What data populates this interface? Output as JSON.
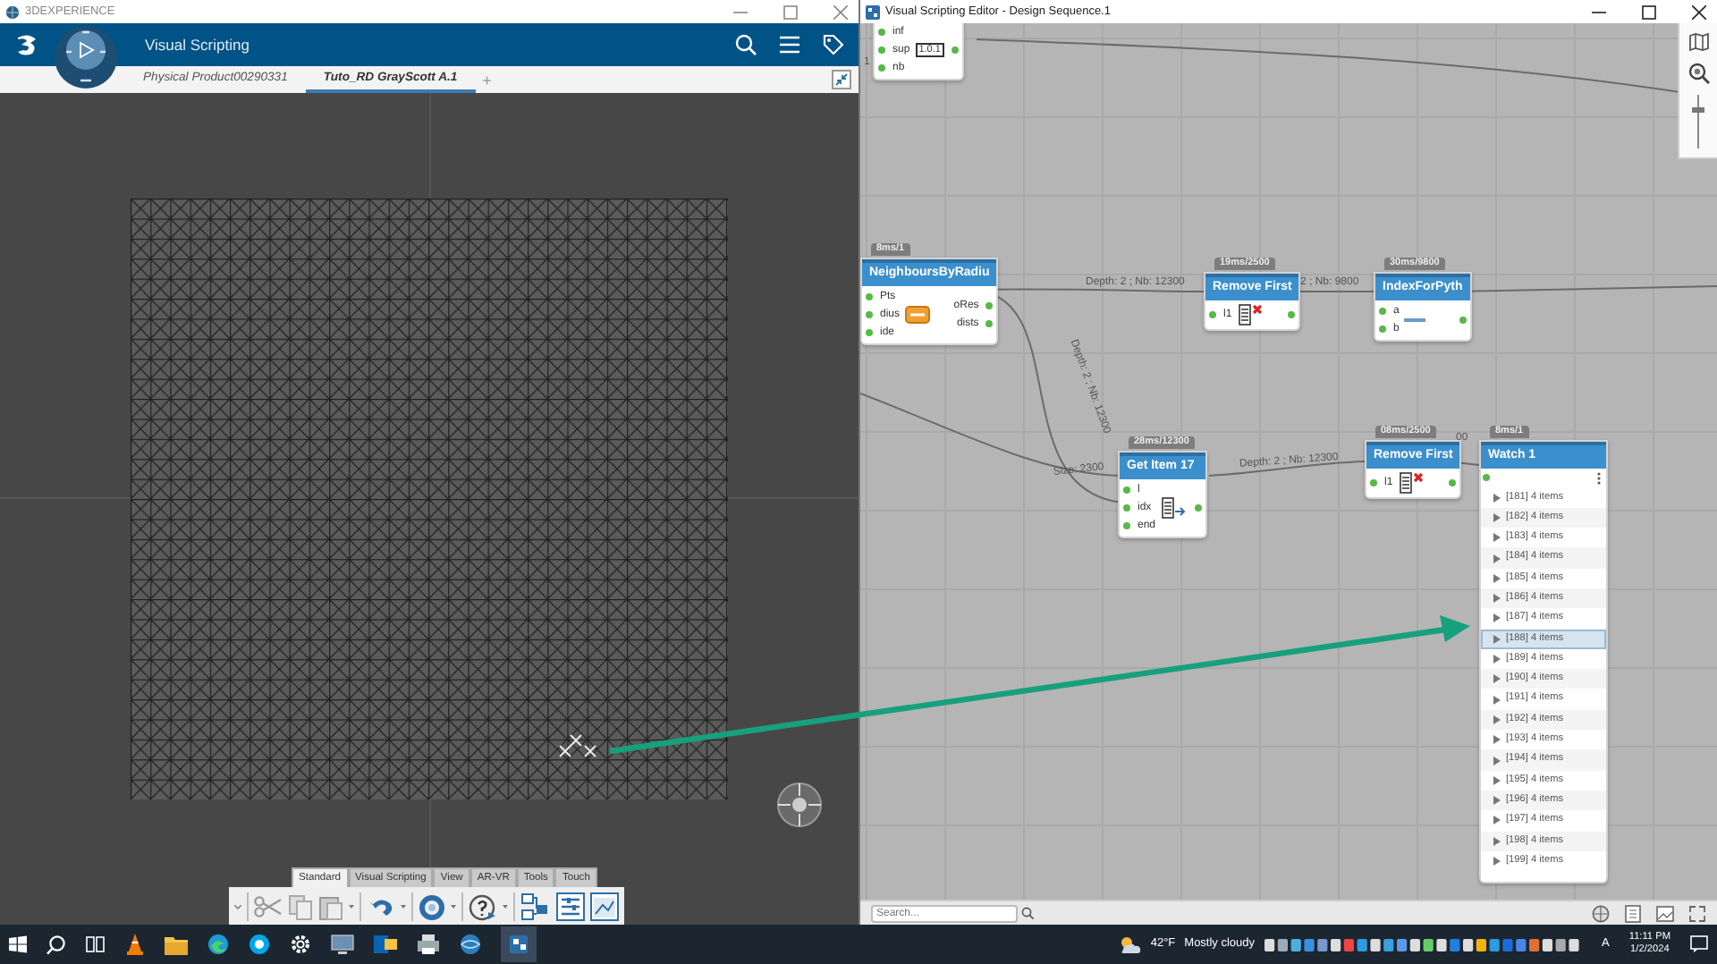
{
  "left_window": {
    "title": "3DEXPERIENCE",
    "app_title": "Visual Scripting",
    "tabs": [
      {
        "label": "Physical Product00290331",
        "selected": false
      },
      {
        "label": "Tuto_RD GrayScott A.1",
        "selected": true
      }
    ],
    "add_tab": "+",
    "toolbar_tabs": [
      {
        "label": "Standard",
        "selected": true
      },
      {
        "label": "Visual Scripting",
        "selected": false
      },
      {
        "label": "View",
        "selected": false
      },
      {
        "label": "AR-VR",
        "selected": false
      },
      {
        "label": "Tools",
        "selected": false
      },
      {
        "label": "Touch",
        "selected": false
      }
    ]
  },
  "editor_window": {
    "title": "Visual Scripting Editor - Design Sequence.1",
    "nodes": [
      {
        "kind": "range",
        "inputs": [
          {
            "label": "inf"
          },
          {
            "label": "sup",
            "value": "1.0.1"
          },
          {
            "label": "nb"
          }
        ]
      },
      {
        "kind": "neighbours",
        "timing": "8ms/1",
        "title": "NeighboursByRadiu",
        "inputs": [
          {
            "label": "Pts"
          },
          {
            "label": "dius"
          },
          {
            "label": "ide"
          }
        ],
        "outputs": [
          "oRes",
          "dists"
        ]
      },
      {
        "kind": "remove",
        "timing": "19ms/2500",
        "title": "Remove First",
        "inputs": [
          {
            "label": "l1"
          }
        ]
      },
      {
        "kind": "index",
        "timing": "30ms/9800",
        "title": "IndexForPyth",
        "inputs": [
          {
            "label": "a"
          },
          {
            "label": "b"
          }
        ]
      },
      {
        "kind": "get",
        "timing": "28ms/12300",
        "title": "Get Item 17",
        "inputs": [
          {
            "label": "l"
          },
          {
            "label": "idx"
          },
          {
            "label": "end"
          }
        ]
      },
      {
        "kind": "remove",
        "timing": "08ms/2500",
        "title": "Remove First",
        "inputs": [
          {
            "label": "l1"
          }
        ]
      }
    ],
    "edge_labels": [
      "1",
      "Depth: 2 ; Nb: 12300",
      "2 ; Nb: 9800",
      "Depth: 2 ; Nb: 12300",
      "Size: 2300",
      "Depth: 2 ; Nb: 12300",
      "00"
    ],
    "watch": {
      "timing": "8ms/1",
      "title": "Watch 1",
      "items": [
        {
          "label": "[181] 4 items",
          "selected": false
        },
        {
          "label": "[182] 4 items",
          "selected": false
        },
        {
          "label": "[183] 4 items",
          "selected": false
        },
        {
          "label": "[184] 4 items",
          "selected": false
        },
        {
          "label": "[185] 4 items",
          "selected": false
        },
        {
          "label": "[186] 4 items",
          "selected": false
        },
        {
          "label": "[187] 4 items",
          "selected": false
        },
        {
          "label": "[188] 4 items",
          "selected": true
        },
        {
          "label": "[189] 4 items",
          "selected": false
        },
        {
          "label": "[190] 4 items",
          "selected": false
        },
        {
          "label": "[191] 4 items",
          "selected": false
        },
        {
          "label": "[192] 4 items",
          "selected": false
        },
        {
          "label": "[193] 4 items",
          "selected": false
        },
        {
          "label": "[194] 4 items",
          "selected": false
        },
        {
          "label": "[195] 4 items",
          "selected": false
        },
        {
          "label": "[196] 4 items",
          "selected": false
        },
        {
          "label": "[197] 4 items",
          "selected": false
        },
        {
          "label": "[198] 4 items",
          "selected": false
        },
        {
          "label": "[199] 4 items",
          "selected": false
        }
      ]
    },
    "zoom_slider": {
      "level": 0.75
    },
    "search": {
      "placeholder": "Search..."
    }
  },
  "taskbar": {
    "weather_temp": "42°F",
    "weather_text": "Mostly cloudy",
    "input_indicator": "A",
    "time": "11:11 PM",
    "date": "1/2/2024"
  }
}
